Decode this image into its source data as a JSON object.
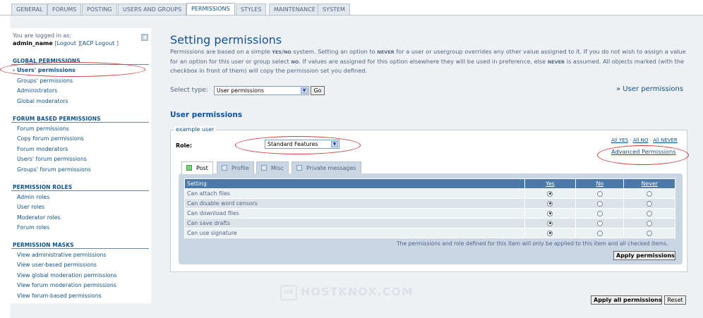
{
  "top_tabs": [
    "GENERAL",
    "FORUMS",
    "POSTING",
    "USERS AND GROUPS",
    "PERMISSIONS",
    "STYLES",
    "MAINTENANCE",
    "SYSTEM"
  ],
  "active_tab": "PERMISSIONS",
  "login": {
    "line1": "You are logged in as:",
    "username": "admin_name",
    "logout": "Logout",
    "acp_logout": "ACP Logout",
    "sep_open": "[",
    "sep_mid": "][",
    "sep_close": "]"
  },
  "collapse_icon": "arrow-left-icon",
  "sidebar": {
    "groups": [
      {
        "title": "GLOBAL PERMISSIONS",
        "items": [
          "Users' permissions",
          "Groups' permissions",
          "Administrators",
          "Global moderators"
        ]
      },
      {
        "title": "FORUM BASED PERMISSIONS",
        "items": [
          "Forum permissions",
          "Copy forum permissions",
          "Forum moderators",
          "Users' forum permissions",
          "Groups' forum permissions"
        ]
      },
      {
        "title": "PERMISSION ROLES",
        "items": [
          "Admin roles",
          "User roles",
          "Moderator roles",
          "Forum roles"
        ]
      },
      {
        "title": "PERMISSION MASKS",
        "items": [
          "View administrative permissions",
          "View user-based permissions",
          "View global moderation permissions",
          "View forum moderation permissions",
          "View forum-based permissions"
        ]
      }
    ],
    "active_item": "Users' permissions",
    "active_marker": "›"
  },
  "main": {
    "title": "Setting permissions",
    "desc_parts": [
      "Permissions are based on a simple ",
      "YES",
      "/",
      "NO",
      " system. Setting an option to ",
      "NEVER",
      " for a user or usergroup overrides any other value assigned to it. If you do not wish to assign a value for an option for this user or group select ",
      "NO",
      ". If values are assigned for this option elsewhere they will be used in preference, else ",
      "NEVER",
      " is assumed. All objects marked (with the checkbox in front of them) will copy the permission set you defined."
    ],
    "select_type_label": "Select type:",
    "select_type_value": "User permissions",
    "go_button": "Go",
    "breadcrumb_right": "» User permissions",
    "section_title": "User permissions",
    "fieldset_legend": "example user",
    "role_label": "Role:",
    "role_value": "Standard Features",
    "all_yes": "All YES",
    "all_no": "All NO",
    "all_never": "All NEVER",
    "advanced_permissions": "Advanced Permissions",
    "tabs": [
      "Post",
      "Profile",
      "Misc",
      "Private messages"
    ],
    "active_subtab": "Post",
    "table_headers": [
      "Setting",
      "Yes",
      "No",
      "Never"
    ],
    "rows": [
      {
        "setting": "Can attach files",
        "value": "yes"
      },
      {
        "setting": "Can disable word censors",
        "value": "yes"
      },
      {
        "setting": "Can download files",
        "value": "yes"
      },
      {
        "setting": "Can save drafts",
        "value": "yes"
      },
      {
        "setting": "Can use signature",
        "value": "yes"
      }
    ],
    "note": "The permissions and role defined for this item will only be applied to this item and all checked items.",
    "apply_permissions": "Apply permissions",
    "apply_all": "Apply all permissions",
    "reset": "Reset"
  },
  "watermark": "HOSTKNOX.COM",
  "annotation_color": "#d23b3b"
}
